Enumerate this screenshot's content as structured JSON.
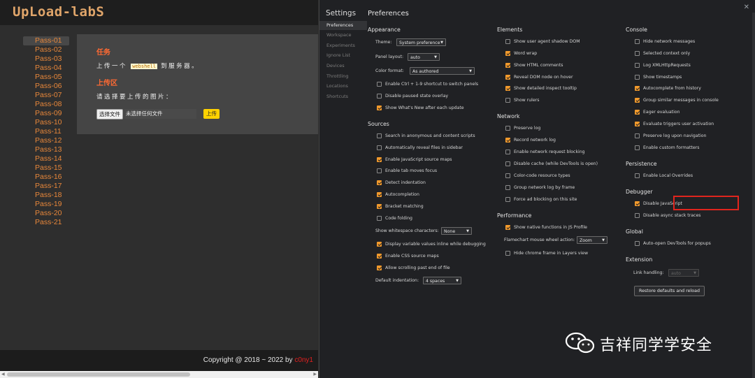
{
  "site": {
    "logo": "UpLoad-labS",
    "nav": [
      "Pass-01",
      "Pass-02",
      "Pass-03",
      "Pass-04",
      "Pass-05",
      "Pass-06",
      "Pass-07",
      "Pass-08",
      "Pass-09",
      "Pass-10",
      "Pass-11",
      "Pass-12",
      "Pass-13",
      "Pass-14",
      "Pass-15",
      "Pass-16",
      "Pass-17",
      "Pass-18",
      "Pass-19",
      "Pass-20",
      "Pass-21"
    ],
    "task_title": "任务",
    "task_prefix": "上传一个",
    "task_code": "webshell",
    "task_suffix": "到服务器。",
    "upload_title": "上传区",
    "upload_prompt": "请选择要上传的图片：",
    "file_button": "选择文件",
    "file_name": "未选择任何文件",
    "upload_button": "上传",
    "copyright": "Copyright @ 2018 ~ 2022 by",
    "author": "c0ny1"
  },
  "devtools": {
    "settings_title": "Settings",
    "sidebar": [
      "Preferences",
      "Workspace",
      "Experiments",
      "Ignore List",
      "Devices",
      "Throttling",
      "Locations",
      "Shortcuts"
    ],
    "page_title": "Preferences",
    "close": "✕",
    "appearance": {
      "title": "Appearance",
      "theme_label": "Theme:",
      "theme_value": "System preference",
      "panel_label": "Panel layout:",
      "panel_value": "auto",
      "color_label": "Color format:",
      "color_value": "As authored",
      "cb1": "Enable Ctrl + 1-9 shortcut to switch panels",
      "cb2": "Disable paused state overlay",
      "cb3": "Show What's New after each update"
    },
    "sources": {
      "title": "Sources",
      "items": [
        "Search in anonymous and content scripts",
        "Automatically reveal files in sidebar",
        "Enable JavaScript source maps",
        "Enable tab moves focus",
        "Detect indentation",
        "Autocompletion",
        "Bracket matching",
        "Code folding"
      ],
      "ws_label": "Show whitespace characters:",
      "ws_value": "None",
      "items2": [
        "Display variable values inline while debugging",
        "Enable CSS source maps",
        "Allow scrolling past end of file"
      ],
      "indent_label": "Default indentation:",
      "indent_value": "4 spaces"
    },
    "elements": {
      "title": "Elements",
      "items": [
        "Show user agent shadow DOM",
        "Word wrap",
        "Show HTML comments",
        "Reveal DOM node on hover",
        "Show detailed inspect tooltip",
        "Show rulers"
      ]
    },
    "network": {
      "title": "Network",
      "items": [
        "Preserve log",
        "Record network log",
        "Enable network request blocking",
        "Disable cache (while DevTools is open)",
        "Color-code resource types",
        "Group network log by frame",
        "Force ad blocking on this site"
      ]
    },
    "performance": {
      "title": "Performance",
      "cb1": "Show native functions in JS Profile",
      "wheel_label": "Flamechart mouse wheel action:",
      "wheel_value": "Zoom",
      "cb2": "Hide chrome frame in Layers view"
    },
    "console": {
      "title": "Console",
      "items": [
        "Hide network messages",
        "Selected context only",
        "Log XMLHttpRequests",
        "Show timestamps",
        "Autocomplete from history",
        "Group similar messages in console",
        "Eager evaluation",
        "Evaluate triggers user activation",
        "Preserve log upon navigation",
        "Enable custom formatters"
      ]
    },
    "persistence": {
      "title": "Persistence",
      "cb1": "Enable Local Overrides"
    },
    "debugger": {
      "title": "Debugger",
      "cb1": "Disable JavaScript",
      "cb2": "Disable async stack traces"
    },
    "global": {
      "title": "Global",
      "cb1": "Auto-open DevTools for popups"
    },
    "extension": {
      "title": "Extension",
      "link_label": "Link handling:",
      "link_value": "auto",
      "restore": "Restore defaults and reload"
    }
  },
  "watermark": "吉祥同学学安全",
  "colors": {
    "accent": "#f29a2c",
    "nav_link": "#e8873a",
    "section_title": "#ff6a33",
    "highlight": "#e0251d"
  }
}
